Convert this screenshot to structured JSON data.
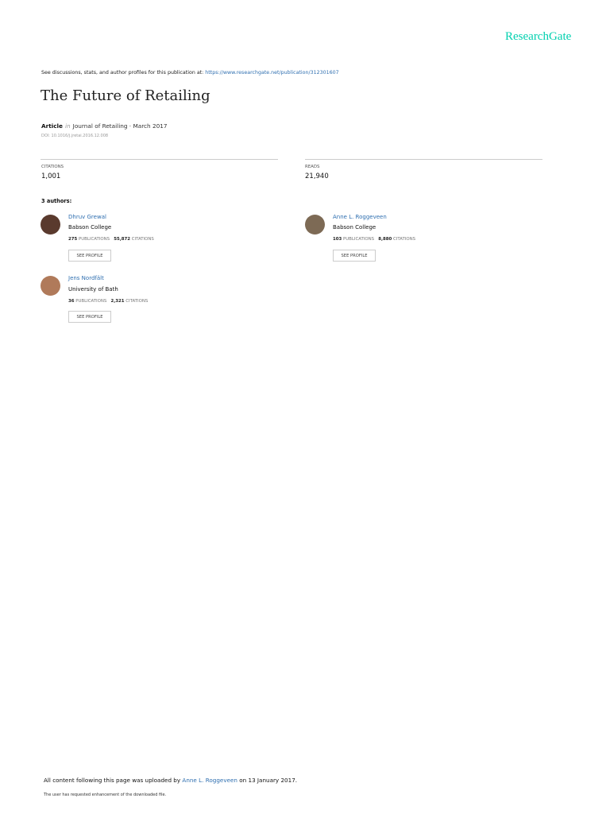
{
  "brand": "ResearchGate",
  "header": {
    "prefix": "See discussions, stats, and author profiles for this publication at: ",
    "url": "https://www.researchgate.net/publication/312301607"
  },
  "title": "The Future of Retailing",
  "meta": {
    "type": "Article",
    "in": "in",
    "journal": "Journal of Retailing · March 2017",
    "doi": "DOI: 10.1016/j.jretai.2016.12.008"
  },
  "stats": {
    "citations_label": "CITATIONS",
    "citations": "1,001",
    "reads_label": "READS",
    "reads": "21,940"
  },
  "authors_heading": "3 authors:",
  "authors": [
    {
      "name": "Dhruv Grewal",
      "institution": "Babson College",
      "publications": "275",
      "publications_label": "PUBLICATIONS",
      "citations": "55,872",
      "citations_label": "CITATIONS",
      "button": "SEE PROFILE",
      "avatar_color": "#5a3a2e"
    },
    {
      "name": "Anne L. Roggeveen",
      "institution": "Babson College",
      "publications": "103",
      "publications_label": "PUBLICATIONS",
      "citations": "8,880",
      "citations_label": "CITATIONS",
      "button": "SEE PROFILE",
      "avatar_color": "#7d6a55"
    },
    {
      "name": "Jens Nordfält",
      "institution": "University of Bath",
      "publications": "36",
      "publications_label": "PUBLICATIONS",
      "citations": "2,321",
      "citations_label": "CITATIONS",
      "button": "SEE PROFILE",
      "avatar_color": "#b07a5a"
    }
  ],
  "footer": {
    "prefix": "All content following this page was uploaded by ",
    "uploader": "Anne L. Roggeveen",
    "suffix": " on 13 January 2017.",
    "note": "The user has requested enhancement of the downloaded file."
  }
}
